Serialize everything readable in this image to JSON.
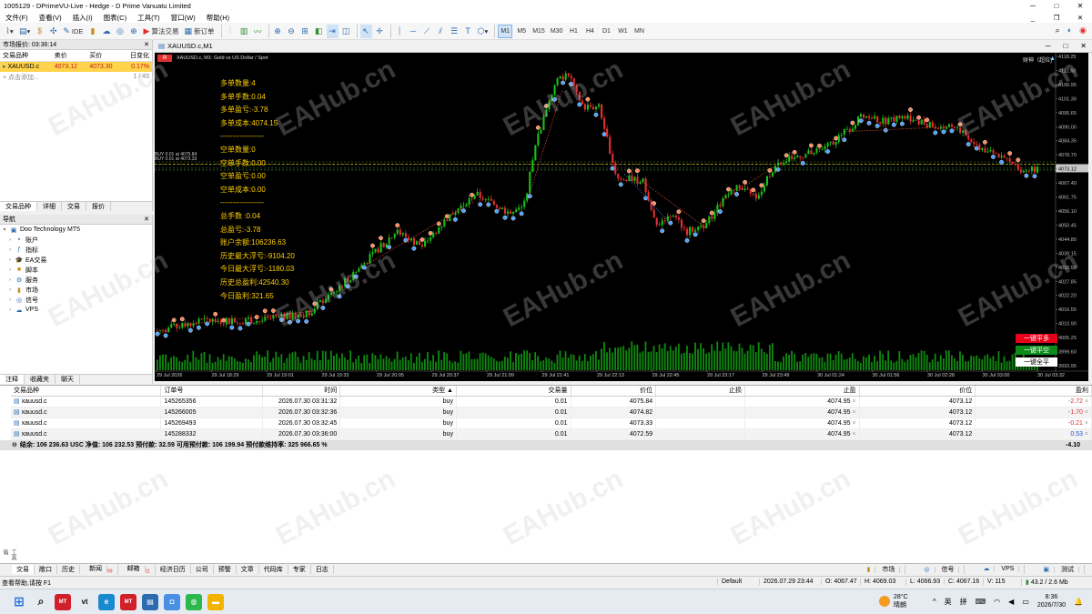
{
  "window": {
    "title": "1005129 - DPrimeVU-Live - Hedge - D Prime Vanuatu Limited",
    "controls": [
      "─",
      "□",
      "✕"
    ]
  },
  "menu": {
    "items": [
      "文件(F)",
      "查看(V)",
      "插入(I)",
      "图表(C)",
      "工具(T)",
      "窗口(W)",
      "帮助(H)"
    ],
    "controls": [
      "_",
      "❐",
      "✕"
    ]
  },
  "toolbar": {
    "ide": "IDE",
    "algo": "算法交易",
    "neworder": "新订单",
    "timeframes": [
      "M1",
      "M5",
      "M15",
      "M30",
      "H1",
      "H4",
      "D1",
      "W1",
      "MN"
    ],
    "active_tf": "M1"
  },
  "market_watch": {
    "title": "市场报价: 03:36:14",
    "close": "✕",
    "headers": [
      "交易品种",
      "卖价",
      "买价",
      "日变化"
    ],
    "rows": [
      {
        "symbol": "XAUUSD.c",
        "bid": "4073.12",
        "ask": "4073.30",
        "change": "0.17%"
      }
    ],
    "add_label": "点击添加...",
    "count": "1 / 43",
    "tabs": [
      "交易品种",
      "详细",
      "交易",
      "报价"
    ]
  },
  "navigator": {
    "title": "导航",
    "close": "✕",
    "root": "Doo Technology MT5",
    "items": [
      "账户",
      "指标",
      "EA交易",
      "脚本",
      "服务",
      "市场",
      "信号",
      "VPS"
    ],
    "tabs": [
      "注释",
      "收藏夹",
      "聊天"
    ]
  },
  "chart_window": {
    "title": "XAUUSD.c,M1",
    "controls": [
      "─",
      "□",
      "✕"
    ],
    "label": "XAUUSD.c, M1:  Gold vs US Dollar / Spot",
    "corner": "财神（超拉)"
  },
  "overlay": {
    "lines": [
      "多单数量:4",
      "多单手数:0.04",
      "多单盈亏:-3.78",
      "多单成本:4074.15",
      "------------------",
      "空单数量:0",
      "空单手数:0.00",
      "空单盈亏:0.00",
      "空单成本:0.00",
      "------------------",
      "总手数 :0.04",
      "总盈亏:-3.78",
      "账户余额:106236.63",
      "历史最大浮亏:-9104.20",
      "今日最大浮亏:-1180.03",
      "历史总盈利:42540.30",
      "今日盈利:321.65"
    ],
    "hlabels": [
      "BUY 0.01 at 4075.84",
      "BUY 0.01 at 4073.33"
    ]
  },
  "buttons": {
    "close_buy": "一键平多",
    "close_sell": "一键平空",
    "close_all": "一键全平"
  },
  "price_axis": {
    "ticks": [
      "4118.25",
      "4112.60",
      "4106.95",
      "4101.30",
      "4095.65",
      "4090.00",
      "4084.35",
      "4078.70",
      "4073.12",
      "4067.40",
      "4061.75",
      "4056.10",
      "4050.45",
      "4044.80",
      "4039.15",
      "4033.50",
      "4027.85",
      "4022.20",
      "4016.55",
      "4010.90",
      "4005.25",
      "3999.60",
      "3993.95"
    ],
    "current": "4073.12"
  },
  "time_axis": [
    "29 Jul 2026",
    "29 Jul 18:29",
    "29 Jul 19:01",
    "29 Jul 19:33",
    "29 Jul 20:05",
    "29 Jul 20:37",
    "29 Jul 21:09",
    "29 Jul 21:41",
    "29 Jul 22:13",
    "29 Jul 22:45",
    "29 Jul 23:17",
    "29 Jul 23:49",
    "30 Jul 01:24",
    "30 Jul 01:56",
    "30 Jul 02:28",
    "30 Jul 03:00",
    "30 Jul 03:32"
  ],
  "terminal": {
    "headers": [
      "交易品种",
      "订单号",
      "时间",
      "类型 ▲",
      "交易量",
      "价位",
      "止损",
      "止盈",
      "价位",
      "盈利"
    ],
    "rows": [
      {
        "symbol": "xauusd.c",
        "ticket": "145265356",
        "time": "2026.07.30 03:31:32",
        "type": "buy",
        "volume": "0.01",
        "price": "4075.84",
        "sl": "",
        "tp": "4074.95",
        "cur": "4073.12",
        "profit": "-2.72"
      },
      {
        "symbol": "xauusd.c",
        "ticket": "145266005",
        "time": "2026.07.30 03:32:36",
        "type": "buy",
        "volume": "0.01",
        "price": "4074.82",
        "sl": "",
        "tp": "4074.95",
        "cur": "4073.12",
        "profit": "-1.70"
      },
      {
        "symbol": "xauusd.c",
        "ticket": "145269493",
        "time": "2026.07.30 03:32:45",
        "type": "buy",
        "volume": "0.01",
        "price": "4073.33",
        "sl": "",
        "tp": "4074.95",
        "cur": "4073.12",
        "profit": "-0.21"
      },
      {
        "symbol": "xauusd.c",
        "ticket": "145288332",
        "time": "2026.07.30 03:36:00",
        "type": "buy",
        "volume": "0.01",
        "price": "4072.59",
        "sl": "",
        "tp": "4074.95",
        "cur": "4073.12",
        "profit": "0.53"
      }
    ],
    "balance": "结余: 106 236.63 USC  净值: 106 232.53  预付款: 32.59  可用预付款: 106 199.94  预付款维持率: 325 966.65 %",
    "total": "-4.10",
    "tabs": [
      "交易",
      "敞口",
      "历史",
      "新闻",
      "邮箱",
      "经济日历",
      "公司",
      "预警",
      "文章",
      "代码库",
      "专家",
      "日志"
    ],
    "badges": {
      "news": "99",
      "mail": "11"
    },
    "side_label": "工具箱",
    "right": [
      "市场",
      "信号",
      "VPS",
      "测试"
    ]
  },
  "status": {
    "help": "查看帮助,请按 F1",
    "profile": "Default",
    "datetime": "2026.07.29 23:44",
    "open": "O: 4067.47",
    "high": "H: 4069.03",
    "low": "L: 4066.93",
    "close": "C: 4067.16",
    "vol": "V: 115",
    "traffic": "43.2 / 2.6 Mb"
  },
  "taskbar": {
    "weather_temp": "28°C",
    "weather_desc": "晴朗",
    "ime1": "英",
    "ime2": "拼",
    "time": "8:36",
    "date": "2026/7/30"
  },
  "watermark": "EAHub.cn",
  "colors": {
    "bull": "#18c018",
    "bear": "#e03030",
    "overlay": "#ffd000",
    "volume": "#0f8a0f",
    "buy_marker": "#4aa3ff",
    "sell_marker": "#ff8a5a"
  }
}
